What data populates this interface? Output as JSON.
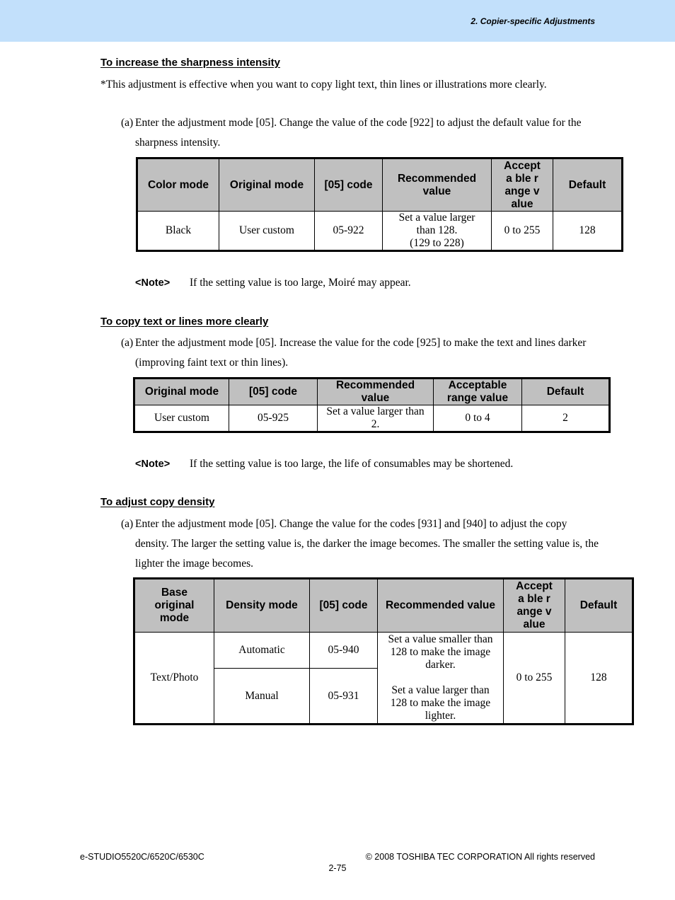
{
  "header": {
    "title": "2. Copier-specific Adjustments",
    "band_color": "#c2e0fb"
  },
  "section1": {
    "heading": "To increase the sharpness intensity",
    "intro": "*This adjustment is effective when you want to copy light text, thin lines or illustrations more clearly.",
    "step_label": "(a)",
    "step_text": "Enter the adjustment mode [05]. Change the value of the code [922] to adjust the default value for the sharpness intensity.",
    "table": {
      "headers": [
        "Color mode",
        "Original mode",
        "[05] code",
        "Recommended value",
        "Accepta ble range value",
        "Default"
      ],
      "rows": [
        {
          "color_mode": "Black",
          "original_mode": "User custom",
          "code": "05-922",
          "recommended": [
            "Set a value larger",
            "than 128.",
            "(129 to 228)"
          ],
          "range": "0 to 255",
          "default": "128"
        }
      ]
    },
    "note_label": "<Note>",
    "note_text": "If the setting value is too large, Moiré may appear."
  },
  "section2": {
    "heading": "To copy text or lines more clearly",
    "step_label": "(a)",
    "step_text": "Enter the adjustment mode [05]. Increase the value for the code [925] to make the text and lines darker (improving faint text or thin lines).",
    "table": {
      "headers": [
        "Original mode",
        "[05] code",
        "Recommended value",
        "Acceptable range value",
        "Default"
      ],
      "rows": [
        {
          "original_mode": "User custom",
          "code": "05-925",
          "recommended": "Set a value larger than 2.",
          "range": "0 to 4",
          "default": "2"
        }
      ]
    },
    "note_label": "<Note>",
    "note_text": "If the setting value is too large, the life of consumables may be shortened."
  },
  "section3": {
    "heading": "To adjust copy density",
    "step_label": "(a)",
    "step_text": "Enter the adjustment mode [05]. Change the value for the codes [931] and [940] to adjust the copy density. The larger the setting value is, the darker the image becomes. The smaller the setting value is, the lighter the image becomes.",
    "table": {
      "headers": [
        "Base original mode",
        "Density mode",
        "[05] code",
        "Recommended value",
        "Accepta ble range value",
        "Default"
      ],
      "base_mode": "Text/Photo",
      "rows": [
        {
          "density_mode": "Automatic",
          "code": "05-940"
        },
        {
          "density_mode": "Manual",
          "code": "05-931"
        }
      ],
      "recommended_1": "Set a value smaller than 128 to make the image darker.",
      "recommended_2": "Set a value larger than 128 to make the image lighter.",
      "range": "0 to 255",
      "default": "128"
    }
  },
  "footer": {
    "model": "e-STUDIO5520C/6520C/6530C",
    "copyright": "© 2008 TOSHIBA TEC CORPORATION All rights reserved",
    "page": "2-75"
  }
}
